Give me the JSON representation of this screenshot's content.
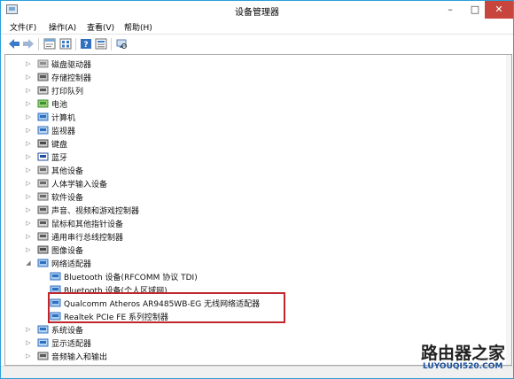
{
  "window": {
    "title": "设备管理器"
  },
  "menu": [
    {
      "label": "文件(F)"
    },
    {
      "label": "操作(A)"
    },
    {
      "label": "查看(V)"
    },
    {
      "label": "帮助(H)"
    }
  ],
  "toolbar": {
    "icons": [
      "back-arrow-icon",
      "forward-arrow-icon",
      "properties-icon",
      "list-icon",
      "help-icon",
      "details-icon",
      "scan-hardware-icon"
    ]
  },
  "tree": [
    {
      "label": "磁盘驱动器",
      "expander": "▷",
      "icon": "disk-drive-icon"
    },
    {
      "label": "存储控制器",
      "expander": "▷",
      "icon": "storage-controller-icon"
    },
    {
      "label": "打印队列",
      "expander": "▷",
      "icon": "printer-icon"
    },
    {
      "label": "电池",
      "expander": "▷",
      "icon": "battery-icon"
    },
    {
      "label": "计算机",
      "expander": "▷",
      "icon": "computer-icon"
    },
    {
      "label": "监视器",
      "expander": "▷",
      "icon": "monitor-icon"
    },
    {
      "label": "键盘",
      "expander": "▷",
      "icon": "keyboard-icon"
    },
    {
      "label": "蓝牙",
      "expander": "▷",
      "icon": "bluetooth-icon"
    },
    {
      "label": "其他设备",
      "expander": "▷",
      "icon": "other-device-icon"
    },
    {
      "label": "人体学输入设备",
      "expander": "▷",
      "icon": "hid-icon"
    },
    {
      "label": "软件设备",
      "expander": "▷",
      "icon": "software-device-icon"
    },
    {
      "label": "声音、视频和游戏控制器",
      "expander": "▷",
      "icon": "sound-icon"
    },
    {
      "label": "鼠标和其他指针设备",
      "expander": "▷",
      "icon": "mouse-icon"
    },
    {
      "label": "通用串行总线控制器",
      "expander": "▷",
      "icon": "usb-icon"
    },
    {
      "label": "图像设备",
      "expander": "▷",
      "icon": "camera-icon"
    },
    {
      "label": "网络适配器",
      "expander": "◢",
      "icon": "network-adapter-icon"
    },
    {
      "label": "Bluetooth 设备(RFCOMM 协议 TDI)",
      "expander": "",
      "icon": "network-adapter-icon",
      "child": true
    },
    {
      "label": "Bluetooth 设备(个人区域网)",
      "expander": "",
      "icon": "network-adapter-icon",
      "child": true
    },
    {
      "label": "Qualcomm Atheros AR9485WB-EG 无线网络适配器",
      "expander": "",
      "icon": "network-adapter-icon",
      "child": true
    },
    {
      "label": "Realtek PCIe FE 系列控制器",
      "expander": "",
      "icon": "network-adapter-icon",
      "child": true
    },
    {
      "label": "系统设备",
      "expander": "▷",
      "icon": "system-device-icon"
    },
    {
      "label": "显示适配器",
      "expander": "▷",
      "icon": "display-adapter-icon"
    },
    {
      "label": "音频输入和输出",
      "expander": "▷",
      "icon": "audio-io-icon"
    }
  ],
  "watermark": {
    "brand": "路由器之家",
    "url": "LUYOUQI520.COM"
  },
  "colors": {
    "accent": "#2b9fd8",
    "highlight": "#c0262c"
  }
}
